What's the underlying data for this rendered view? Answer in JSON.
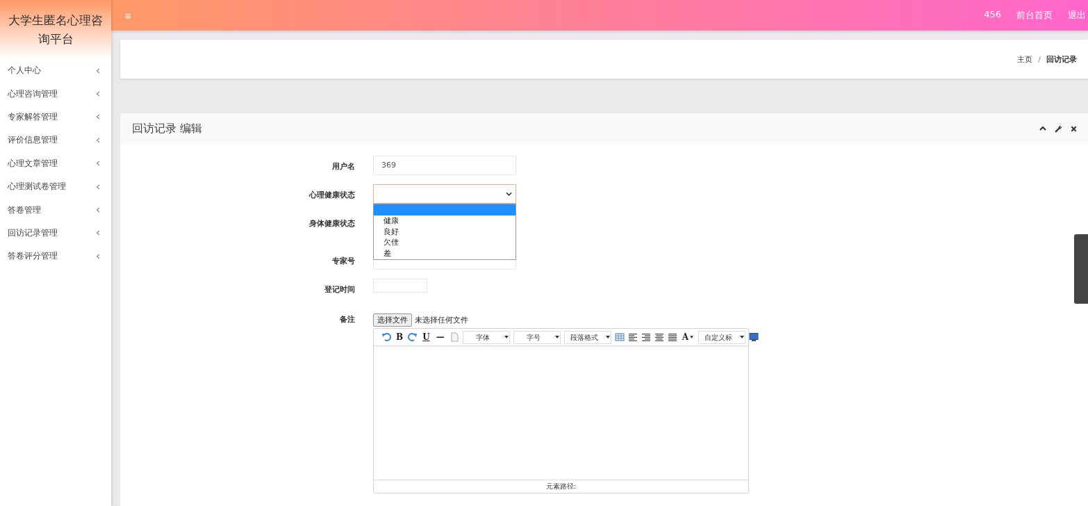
{
  "sidebar": {
    "title": "大学生匿名心理咨询平台",
    "items": [
      {
        "label": "个人中心",
        "expanded": false
      },
      {
        "label": "心理咨询管理",
        "expanded": false
      },
      {
        "label": "专家解答管理",
        "expanded": false
      },
      {
        "label": "评价信息管理",
        "expanded": false
      },
      {
        "label": "心理文章管理",
        "expanded": false
      },
      {
        "label": "心理测试卷管理",
        "expanded": false
      },
      {
        "label": "答卷管理",
        "expanded": false
      },
      {
        "label": "回访记录管理",
        "expanded": false
      },
      {
        "label": "答卷评分管理",
        "expanded": false
      }
    ]
  },
  "topbar": {
    "menu_icon": "≡",
    "user": "456",
    "links": [
      "前台首页",
      "退出"
    ]
  },
  "breadcrumb": {
    "home": "主页",
    "separator": "/",
    "current": "回访记录"
  },
  "panel": {
    "title": "回访记录 编辑",
    "fields": [
      {
        "label": "用户名",
        "kind": "text",
        "value": "369"
      },
      {
        "label": "心理健康状态",
        "kind": "select",
        "open": true,
        "options": [
          {
            "selected": true
          },
          {
            "label": "健康",
            "selected": false
          },
          {
            "label": "良好",
            "selected": false
          },
          {
            "label": "欠佳",
            "selected": false
          },
          {
            "label": "差",
            "selected": false
          }
        ]
      },
      {
        "label": "身体健康状态",
        "kind": "hidden"
      },
      {
        "label": "专家号",
        "kind": "text"
      },
      {
        "label": "登记时间",
        "kind": "date"
      },
      {
        "label": "备注",
        "kind": "editor",
        "file_button": "选择文件",
        "file_status": "未选择任何文件",
        "toolbar": [
          {
            "kind": "undo"
          },
          {
            "kind": "char",
            "text": "B"
          },
          {
            "kind": "redo"
          },
          {
            "kind": "char",
            "text": "U",
            "underline": true
          },
          {
            "kind": "char",
            "text": "—"
          },
          {
            "kind": "doc"
          },
          {
            "kind": "dropdown",
            "text": "字体"
          },
          {
            "kind": "dropdown",
            "text": "字号"
          },
          {
            "kind": "dropdown",
            "text": "段落格式"
          },
          {
            "kind": "table"
          },
          {
            "kind": "align-left"
          },
          {
            "kind": "align-right"
          },
          {
            "kind": "align-center"
          },
          {
            "kind": "align-justify"
          },
          {
            "kind": "char",
            "text": "A",
            "caret": true
          },
          {
            "kind": "dropdown",
            "text": "自定义标"
          },
          {
            "kind": "monitor"
          }
        ],
        "status": "元素路径:"
      }
    ]
  }
}
